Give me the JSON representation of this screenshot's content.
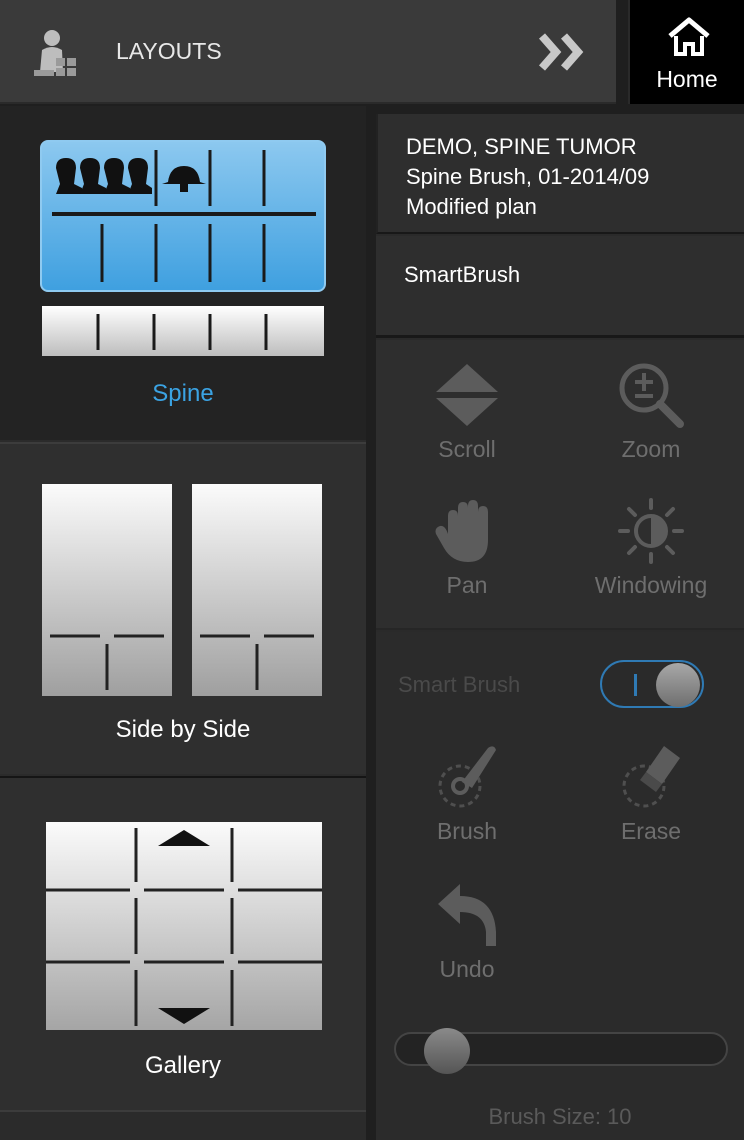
{
  "header": {
    "title": "LAYOUTS",
    "home_label": "Home"
  },
  "layouts": [
    {
      "label": "Spine",
      "active": true
    },
    {
      "label": "Side by Side",
      "active": false
    },
    {
      "label": "Gallery",
      "active": false
    }
  ],
  "patient": {
    "name": "DEMO, SPINE TUMOR",
    "study": "Spine Brush, 01-2014/09",
    "plan": "Modified plan"
  },
  "tool_section": {
    "title": "SmartBrush"
  },
  "tools": {
    "scroll": "Scroll",
    "zoom": "Zoom",
    "pan": "Pan",
    "windowing": "Windowing"
  },
  "smart_brush": {
    "label": "Smart Brush",
    "enabled": true,
    "brush": "Brush",
    "erase": "Erase",
    "undo": "Undo",
    "brush_size_text": "Brush Size: 10",
    "brush_size": 10
  },
  "colors": {
    "accent": "#3ba3e3",
    "toggle_border": "#2f7ab4",
    "disabled_text": "#6e6e6e"
  }
}
